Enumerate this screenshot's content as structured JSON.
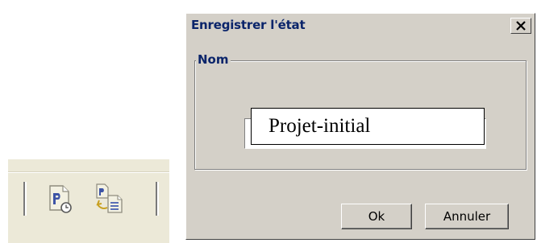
{
  "dialog": {
    "title": "Enregistrer l'état",
    "close_label": "X",
    "group_label": "Nom",
    "name_value": "Projet-initial",
    "ok_label": "Ok",
    "cancel_label": "Annuler"
  },
  "toolbar": {
    "buttons": [
      {
        "icon": "project-document-icon"
      },
      {
        "icon": "compare-documents-icon"
      }
    ]
  },
  "colors": {
    "dialog_face": "#d4d0c8",
    "title_text": "#0a246a",
    "toolbar_face": "#ece9d8"
  }
}
